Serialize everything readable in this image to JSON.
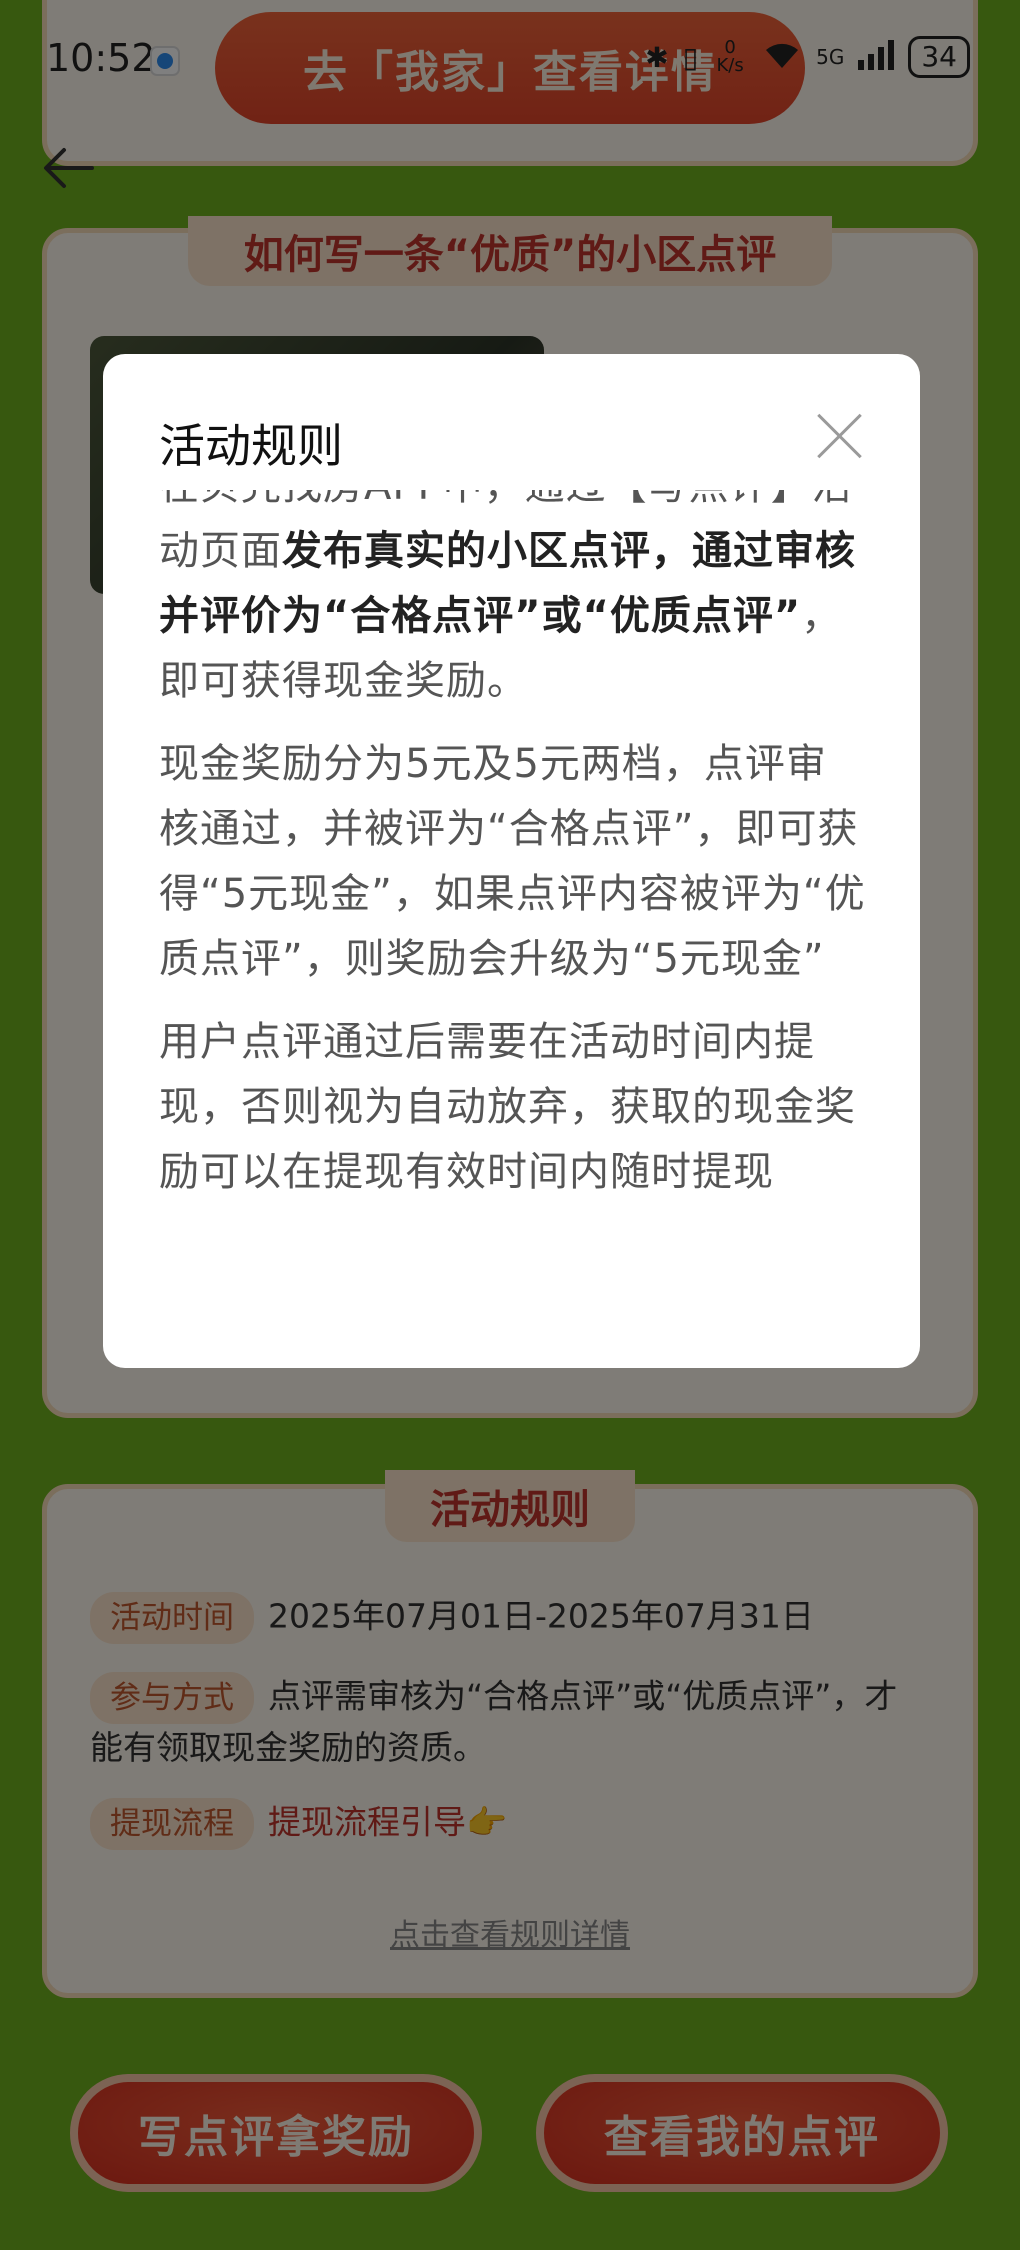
{
  "status_bar": {
    "time": "10:52",
    "network_speed": "0 K/s",
    "network_type": "5G",
    "battery": "34"
  },
  "top_button": {
    "label": "去「我家」查看详情"
  },
  "how_to": {
    "title": "如何写一条“优质”的小区点评"
  },
  "rules_section": {
    "title": "活动规则",
    "time_tag": "活动时间",
    "time_value": "2025年07月01日-2025年07月31日",
    "method_tag": "参与方式",
    "method_value": "点评需审核为“合格点评”或“优质点评”，才能有领取现金奖励的资质。",
    "withdraw_tag": "提现流程",
    "withdraw_link": "提现流程引导👉",
    "detail_link": "点击查看规则详情"
  },
  "bottom_buttons": {
    "write_review": "写点评拿奖励",
    "my_reviews": "查看我的点评"
  },
  "modal": {
    "title": "活动规则",
    "p1_intro": "在贝壳找房APP中，通过【写点评】活动页面",
    "p1_bold": "发布真实的小区点评，通过审核并评价为“合格点评”或“优质点评”",
    "p1_tail": "，即可获得现金奖励。",
    "p2": "现金奖励分为5元及5元两档，点评审核通过，并被评为“合格点评”，即可获得“5元现金”，如果点评内容被评为“优质点评”，则奖励会升级为“5元现金”",
    "p3": "用户点评通过后需要在活动时间内提现，否则视为自动放弃，获取的现金奖励可以在提现有效时间内随时提现"
  }
}
